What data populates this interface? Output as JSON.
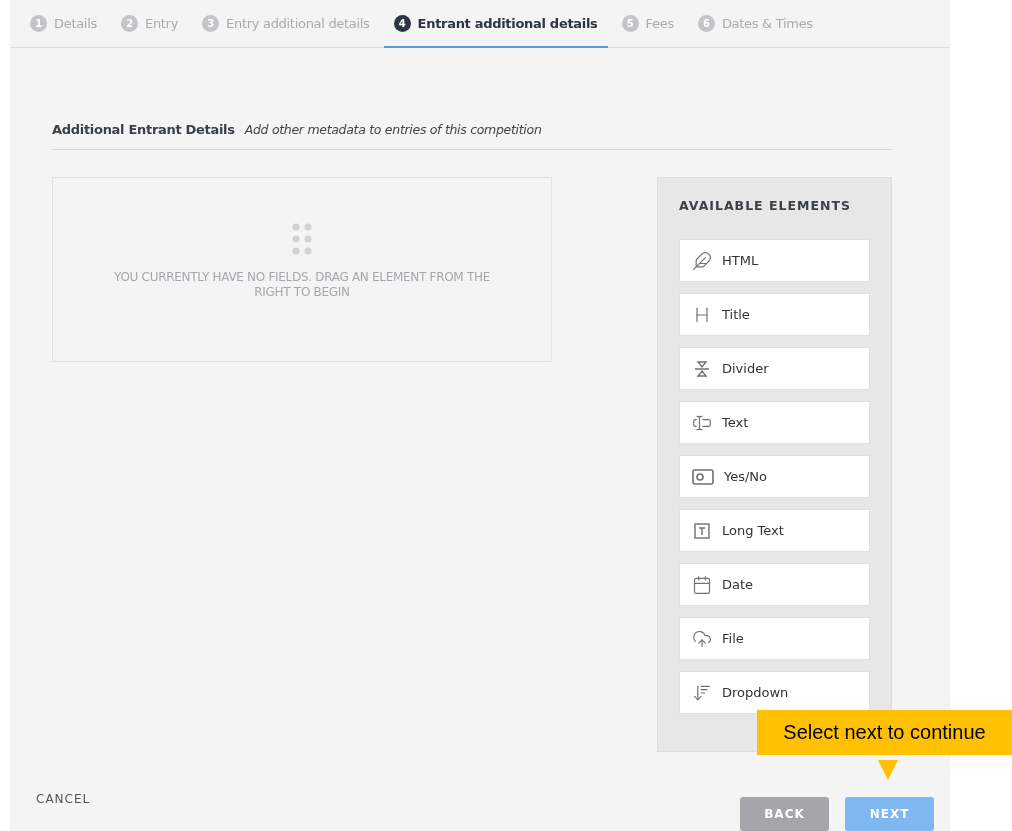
{
  "steps": [
    {
      "number": "1",
      "label": "Details",
      "selected": false
    },
    {
      "number": "2",
      "label": "Entry",
      "selected": false
    },
    {
      "number": "3",
      "label": "Entry additional details",
      "selected": false
    },
    {
      "number": "4",
      "label": "Entrant additional details",
      "selected": true
    },
    {
      "number": "5",
      "label": "Fees",
      "selected": false
    },
    {
      "number": "6",
      "label": "Dates & Times",
      "selected": false
    }
  ],
  "section": {
    "title": "Additional Entrant Details",
    "subtitle": "Add other metadata to entries of this competition"
  },
  "drop_zone": {
    "message": "YOU CURRENTLY HAVE NO FIELDS. DRAG AN ELEMENT FROM THE RIGHT TO BEGIN"
  },
  "available_elements": {
    "title": "AVAILABLE ELEMENTS",
    "items": [
      {
        "label": "HTML",
        "kind": "html"
      },
      {
        "label": "Title",
        "kind": "heading"
      },
      {
        "label": "Divider",
        "kind": "divider"
      },
      {
        "label": "Text",
        "kind": "text"
      },
      {
        "label": "Yes/No",
        "kind": "toggle"
      },
      {
        "label": "Long Text",
        "kind": "longtext"
      },
      {
        "label": "Date",
        "kind": "date"
      },
      {
        "label": "File",
        "kind": "file"
      },
      {
        "label": "Dropdown",
        "kind": "dropdown"
      }
    ]
  },
  "footer": {
    "cancel": "CANCEL",
    "back": "BACK",
    "next": "NEXT"
  },
  "tooltip": {
    "text": "Select next to continue"
  }
}
